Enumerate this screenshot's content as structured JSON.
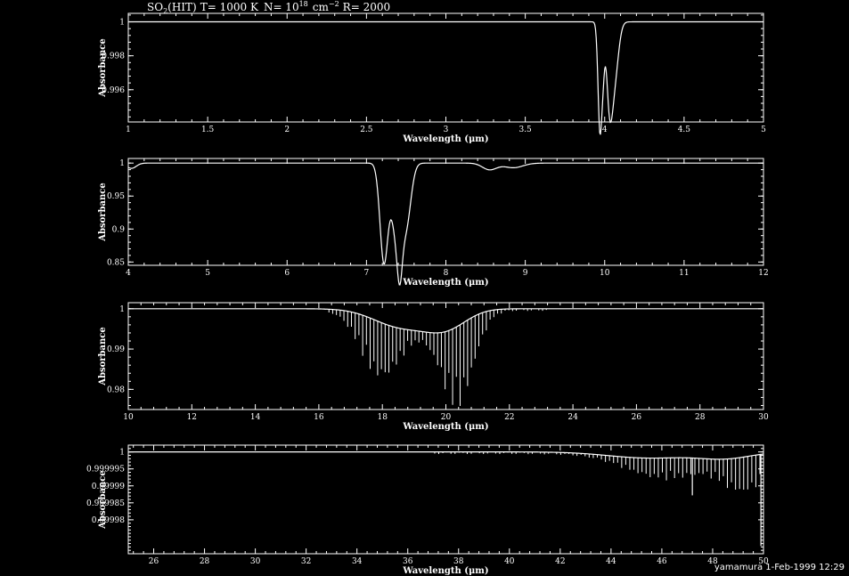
{
  "title": {
    "molecule": "SO",
    "sub": "2",
    "source": "(HIT)",
    "temp": "T= 1000 K",
    "density_prefix": "N= 10",
    "density_exp": "18",
    "unit": "cm",
    "unit_exp": "−2",
    "resolution": "R= 2000"
  },
  "footer": "yamamura  1-Feb-1999 12:29",
  "chart_data": [
    {
      "type": "line",
      "xlabel": "Wavelength (μm)",
      "ylabel": "Absorbance",
      "xlim": [
        1,
        5
      ],
      "ylim": [
        0.9941,
        1.0005
      ],
      "xticks": [
        1,
        1.5,
        2,
        2.5,
        3,
        3.5,
        4,
        4.5,
        5
      ],
      "xtick_labels": [
        "1",
        "1.5",
        "2",
        "2.5",
        "3",
        "3.5",
        "4",
        "4.5",
        "5"
      ],
      "yticks": [
        1,
        0.998,
        0.996
      ],
      "ytick_labels": [
        "1",
        "0.998",
        "0.996"
      ],
      "features": [
        {
          "type": "dip",
          "center": 3.97,
          "depth": 0.0063,
          "width": 0.012
        },
        {
          "type": "dip",
          "center": 4.03,
          "depth": 0.004,
          "width": 0.018
        },
        {
          "type": "dip",
          "center": 4.06,
          "depth": 0.0034,
          "width": 0.025
        },
        {
          "type": "dip",
          "center": 3.99,
          "depth": 0.0022,
          "width": 0.01
        }
      ],
      "x": [
        1,
        3.93,
        3.96,
        3.97,
        3.98,
        3.99,
        4.0,
        4.02,
        4.04,
        4.06,
        4.08,
        4.1,
        5
      ],
      "values": [
        1,
        1,
        0.997,
        0.9943,
        0.996,
        0.9982,
        0.9972,
        0.9968,
        0.9973,
        0.9966,
        0.9978,
        0.9998,
        1
      ]
    },
    {
      "type": "line",
      "xlabel": "Wavelength (μm)",
      "ylabel": "Absorbance",
      "xlim": [
        4,
        12
      ],
      "ylim": [
        0.845,
        1.007
      ],
      "xticks": [
        4,
        5,
        6,
        7,
        8,
        9,
        10,
        11,
        12
      ],
      "xtick_labels": [
        "4",
        "5",
        "6",
        "7",
        "8",
        "9",
        "10",
        "11",
        "12"
      ],
      "yticks": [
        1,
        0.95,
        0.9,
        0.85
      ],
      "ytick_labels": [
        "1",
        "0.95",
        "0.9",
        "0.85"
      ],
      "features": [
        {
          "type": "dip",
          "center": 4.04,
          "depth": 0.008,
          "width": 0.06
        },
        {
          "type": "dip",
          "center": 7.22,
          "depth": 0.15,
          "width": 0.05
        },
        {
          "type": "dip",
          "center": 7.38,
          "depth": 0.11,
          "width": 0.06
        },
        {
          "type": "dip",
          "center": 7.5,
          "depth": 0.09,
          "width": 0.06
        },
        {
          "type": "dip",
          "center": 7.42,
          "depth": 0.06,
          "width": 0.03
        },
        {
          "type": "dip",
          "center": 8.55,
          "depth": 0.01,
          "width": 0.09
        },
        {
          "type": "dip",
          "center": 8.85,
          "depth": 0.007,
          "width": 0.12
        }
      ],
      "x": [
        4,
        7.12,
        7.22,
        7.3,
        7.38,
        7.45,
        7.5,
        7.55,
        8.55,
        8.85,
        12
      ],
      "values": [
        0.993,
        1,
        0.852,
        0.925,
        0.885,
        0.922,
        0.895,
        0.95,
        0.99,
        0.992,
        1
      ]
    },
    {
      "type": "line",
      "xlabel": "Wavelength (μm)",
      "ylabel": "Absorbance",
      "xlim": [
        10,
        30
      ],
      "ylim": [
        0.975,
        1.0015
      ],
      "xticks": [
        10,
        12,
        14,
        16,
        18,
        20,
        22,
        24,
        26,
        28,
        30
      ],
      "xtick_labels": [
        "10",
        "12",
        "14",
        "16",
        "18",
        "20",
        "22",
        "24",
        "26",
        "28",
        "30"
      ],
      "yticks": [
        1,
        0.99,
        0.98
      ],
      "ytick_labels": [
        "1",
        "0.99",
        "0.98"
      ],
      "band": {
        "start": 16.2,
        "end": 23.2,
        "spacing": 0.118
      },
      "features": [
        {
          "type": "envelope",
          "center": 18.6,
          "depth": 0.0045,
          "width": 0.85
        },
        {
          "type": "envelope",
          "center": 20.0,
          "depth": 0.0045,
          "width": 0.65
        },
        {
          "type": "lines",
          "center": 17.9,
          "depth": 0.014,
          "width": 0.6
        },
        {
          "type": "lines",
          "center": 20.4,
          "depth": 0.02,
          "width": 0.5
        }
      ],
      "x": [
        10,
        16.2,
        17.9,
        18.6,
        19.3,
        20.0,
        20.4,
        23.2,
        30
      ],
      "values": [
        1,
        1,
        0.986,
        0.996,
        0.999,
        0.995,
        0.9775,
        0.9995,
        1
      ]
    },
    {
      "type": "line",
      "xlabel": "Wavelength (μm)",
      "ylabel": "Absorbance",
      "xlim": [
        25,
        50
      ],
      "ylim": [
        0.99997,
        1.000002
      ],
      "xticks": [
        26,
        28,
        30,
        32,
        34,
        36,
        38,
        40,
        42,
        44,
        46,
        48,
        50
      ],
      "xtick_labels": [
        "26",
        "28",
        "30",
        "32",
        "34",
        "36",
        "38",
        "40",
        "42",
        "44",
        "46",
        "48",
        "50"
      ],
      "yticks": [
        1,
        0.999995,
        0.99999,
        0.999985,
        0.99998
      ],
      "ytick_labels": [
        "1",
        "0.999995",
        "0.99999",
        "0.999985",
        "0.99998"
      ],
      "band": {
        "start": 36.9,
        "end": 50,
        "spacing": 0.16
      },
      "features": [
        {
          "type": "envelope",
          "center": 45.5,
          "depth": 1.8e-06,
          "width": 1.6
        },
        {
          "type": "envelope",
          "center": 48.5,
          "depth": 1.8e-06,
          "width": 1.0
        },
        {
          "type": "lines",
          "center": 46.2,
          "depth": 6e-06,
          "width": 1.4
        },
        {
          "type": "lines",
          "center": 49.3,
          "depth": 1e-05,
          "width": 0.8
        },
        {
          "type": "spike",
          "center": 47.2,
          "depth": 1.1e-05,
          "width": 0.02
        },
        {
          "type": "spike",
          "center": 49.9,
          "depth": 2.7e-05,
          "width": 0.02
        }
      ],
      "x": [
        25,
        36.9,
        40,
        43,
        45.2,
        47.2,
        48.5,
        49.5,
        49.9,
        50
      ],
      "values": [
        1,
        1,
        0.999995,
        0.999994,
        0.999985,
        0.999989,
        0.999988,
        0.999989,
        0.999973,
        0.999986
      ]
    }
  ]
}
